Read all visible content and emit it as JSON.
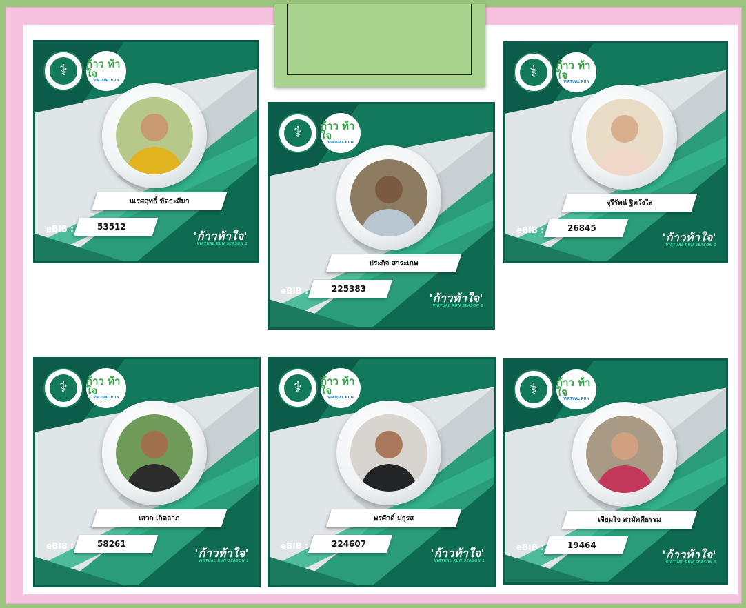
{
  "cards": [
    {
      "name": "นเรศฤทธิ์ ขัดธะสีมา",
      "ebib_label": "eBIB :",
      "ebib": "53512",
      "brand": "'ก้าวท้าใจ'",
      "brand_sub": "VIRTUAL RUN SEASON 1",
      "logo_moph": "MINISTRY OF PUBLIC HEALTH",
      "logo_run": "ก้าว ท้าใจ",
      "logo_run_sub": "VIRTUAL RUN"
    },
    {
      "name": "ประกิจ สาระเกพ",
      "ebib_label": "eBIB :",
      "ebib": "225383",
      "brand": "'ก้าวท้าใจ'",
      "brand_sub": "VIRTUAL RUN SEASON 1",
      "logo_moph": "MINISTRY OF PUBLIC HEALTH",
      "logo_run": "ก้าว ท้าใจ",
      "logo_run_sub": "VIRTUAL RUN"
    },
    {
      "name": "จุรีรัตน์ ฐิตวังใส",
      "ebib_label": "eBIB :",
      "ebib": "26845",
      "brand": "'ก้าวท้าใจ'",
      "brand_sub": "VIRTUAL RUN SEASON 1",
      "logo_moph": "MINISTRY OF PUBLIC HEALTH",
      "logo_run": "ก้าว ท้าใจ",
      "logo_run_sub": "VIRTUAL RUN"
    },
    {
      "name": "เสวก เกิดลาภ",
      "ebib_label": "eBIB :",
      "ebib": "58261",
      "brand": "'ก้าวท้าใจ'",
      "brand_sub": "VIRTUAL RUN SEASON 1",
      "logo_moph": "MINISTRY OF PUBLIC HEALTH",
      "logo_run": "ก้าว ท้าใจ",
      "logo_run_sub": "VIRTUAL RUN"
    },
    {
      "name": "พรศักดิ์ มธุรส",
      "ebib_label": "eBIB :",
      "ebib": "224607",
      "brand": "'ก้าวท้าใจ'",
      "brand_sub": "VIRTUAL RUN SEASON 1",
      "logo_moph": "MINISTRY OF PUBLIC HEALTH",
      "logo_run": "ก้าว ท้าใจ",
      "logo_run_sub": "VIRTUAL RUN"
    },
    {
      "name": "เจียมใจ สามัคคีธรรม",
      "ebib_label": "eBIB :",
      "ebib": "19464",
      "brand": "'ก้าวท้าใจ'",
      "brand_sub": "VIRTUAL RUN SEASON 1",
      "logo_moph": "MINISTRY OF PUBLIC HEALTH",
      "logo_run": "ก้าว ท้าใจ",
      "logo_run_sub": "VIRTUAL RUN"
    }
  ],
  "colors": {
    "background": "#9bc57e",
    "frame": "#f7c2df",
    "card_dark": "#0c5c4a",
    "card_mid": "#1f8a6a",
    "card_light": "#36b08a"
  }
}
